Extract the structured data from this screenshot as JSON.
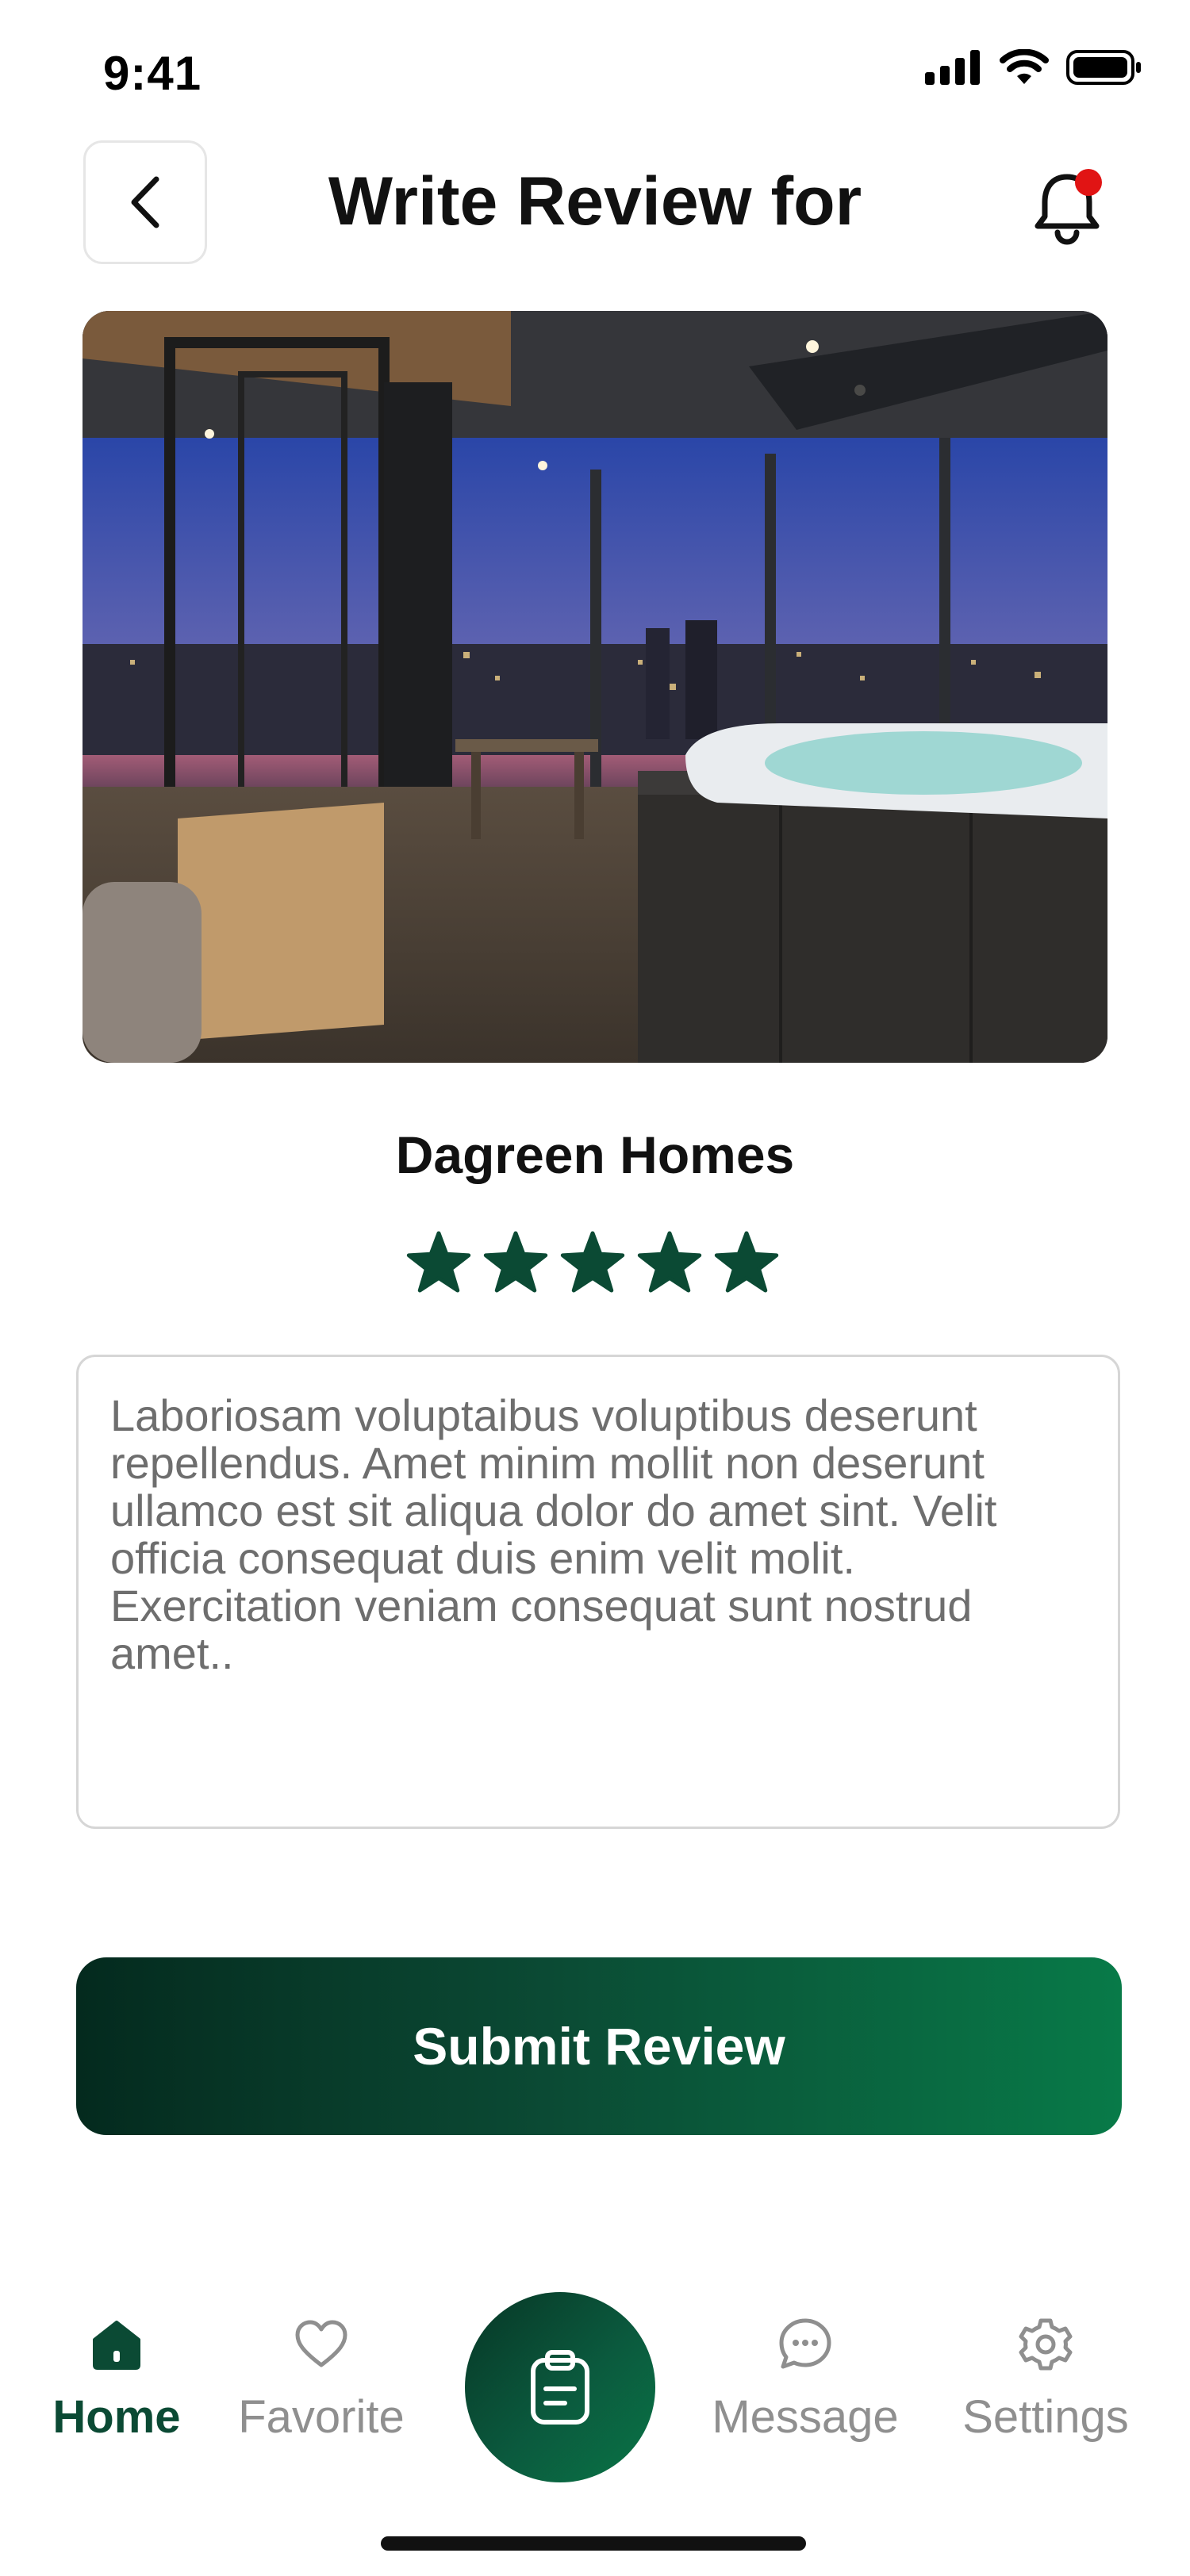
{
  "status_bar": {
    "time": "9:41"
  },
  "header": {
    "title": "Write Review for"
  },
  "property": {
    "name": "Dagreen Homes",
    "rating": 5,
    "rating_max": 5
  },
  "review": {
    "text": "Laboriosam voluptaibus voluptibus deserunt repellendus. Amet minim mollit non deserunt ullamco est sit aliqua dolor do amet sint. Velit officia consequat duis enim velit molit. Exercitation veniam consequat sunt nostrud amet.."
  },
  "submit": {
    "label": "Submit Review"
  },
  "bottom_nav": {
    "items": [
      {
        "label": "Home",
        "icon": "home-icon",
        "active": true
      },
      {
        "label": "Favorite",
        "icon": "heart-icon"
      },
      {
        "label": "",
        "icon": "clipboard-icon"
      },
      {
        "label": "Message",
        "icon": "chat-icon"
      },
      {
        "label": "Settings",
        "icon": "gear-icon"
      }
    ]
  },
  "colors": {
    "brand_dark": "#0b4a34",
    "brand_light": "#087a48",
    "notification_dot": "#e11414",
    "muted_text": "#8f8f8f"
  }
}
